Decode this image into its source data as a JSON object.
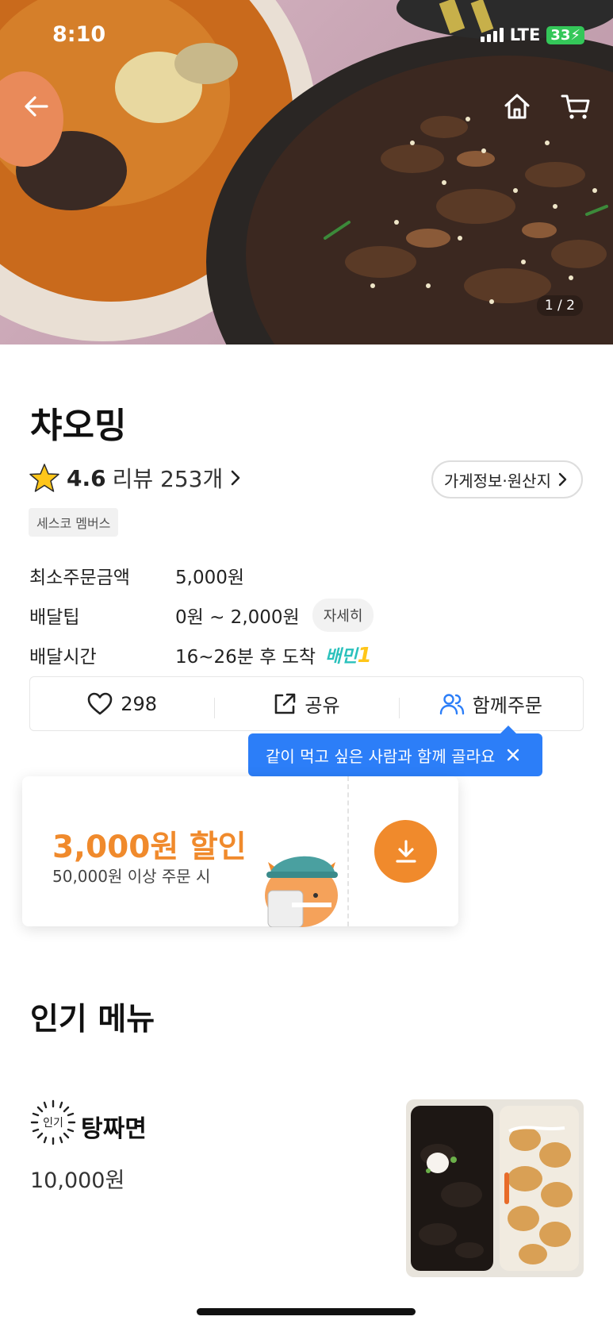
{
  "status_bar": {
    "time": "8:10",
    "network": "LTE",
    "battery": "33"
  },
  "hero": {
    "image_counter": "1 / 2"
  },
  "store": {
    "name": "챠오밍",
    "rating": "4.6",
    "review_text": "리뷰 253개",
    "info_button": "가게정보·원산지",
    "member_badge": "세스코 멤버스"
  },
  "info": {
    "min_order": {
      "label": "최소주문금액",
      "value": "5,000원"
    },
    "delivery_tip": {
      "label": "배달팁",
      "value": "0원 ~ 2,000원",
      "detail": "자세히"
    },
    "delivery_time": {
      "label": "배달시간",
      "value": "16~26분 후 도착",
      "badge": "배민",
      "badge_num": "1"
    }
  },
  "actions": {
    "like_count": "298",
    "share": "공유",
    "group_order": "함께주문"
  },
  "tooltip": {
    "text": "같이 먹고 싶은 사람과 함께 골라요"
  },
  "coupon": {
    "amount": "3,000원 할인",
    "condition": "50,000원 이상 주문 시"
  },
  "popular_menu": {
    "title": "인기 메뉴",
    "items": [
      {
        "badge": "인기",
        "name": "탕짜면",
        "price": "10,000원"
      }
    ]
  },
  "colors": {
    "accent": "#f08a2c",
    "tooltip": "#2c7ef8",
    "baemin": "#2ac1bc",
    "star": "#ffc61a"
  }
}
